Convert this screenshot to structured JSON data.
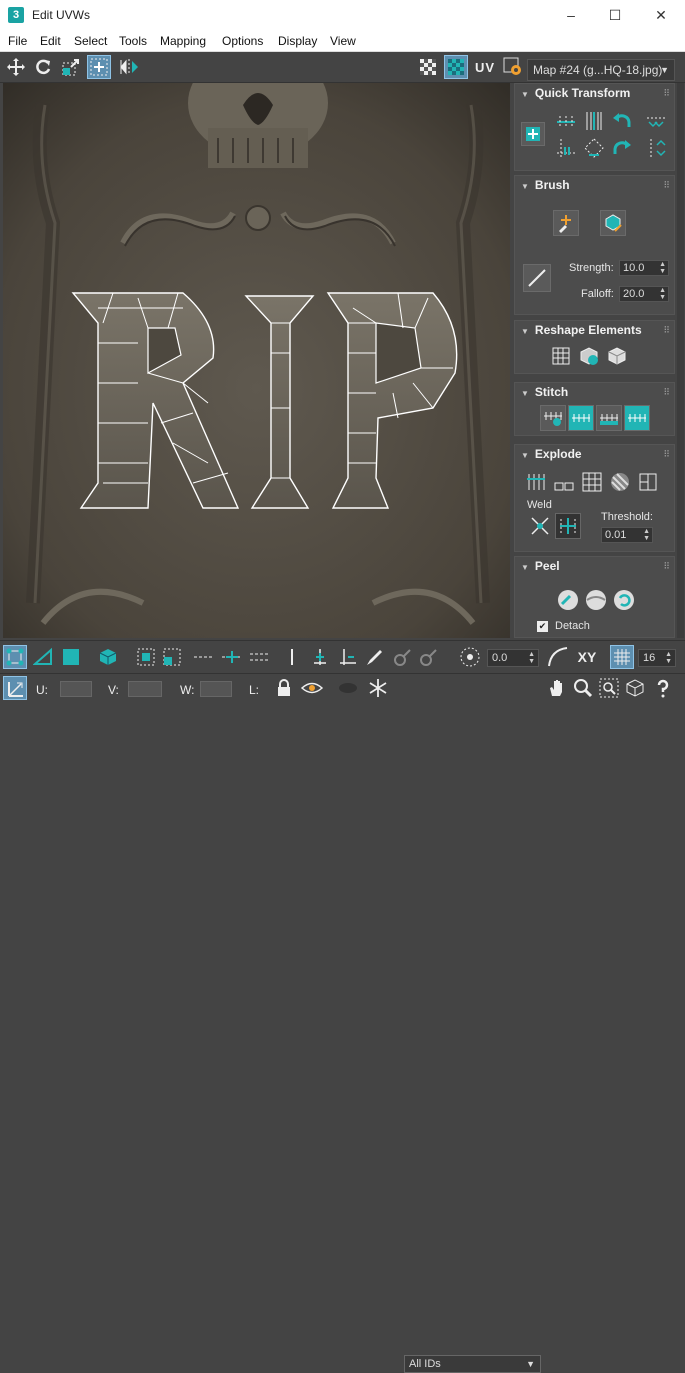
{
  "window": {
    "title": "Edit UVWs",
    "app_icon_label": "3"
  },
  "window_controls": {
    "minimize": "–",
    "maximize": "☐",
    "close": "✕"
  },
  "menu": [
    "File",
    "Edit",
    "Select",
    "Tools",
    "Mapping",
    "Options",
    "Display",
    "View"
  ],
  "toolbar": {
    "uv_label": "UV",
    "map_selector": "Map #24 (g...HQ-18.jpg)"
  },
  "viewport": {
    "texture_letters": "RIP"
  },
  "panels": {
    "quick_transform": {
      "title": "Quick Transform"
    },
    "brush": {
      "title": "Brush",
      "strength_label": "Strength:",
      "strength_value": "10.0",
      "falloff_label": "Falloff:",
      "falloff_value": "20.0"
    },
    "reshape_elements": {
      "title": "Reshape Elements"
    },
    "stitch": {
      "title": "Stitch"
    },
    "explode": {
      "title": "Explode",
      "weld_label": "Weld",
      "threshold_label": "Threshold:",
      "threshold_value": "0.01"
    },
    "peel": {
      "title": "Peel",
      "detach_label": "Detach",
      "detach_checked": true
    }
  },
  "bottom_toolbar": {
    "rotate_value": "0.0",
    "xy_label": "XY",
    "grid_value": "16",
    "u_label": "U:",
    "v_label": "V:",
    "w_label": "W:",
    "l_label": "L:",
    "id_filter": "All IDs"
  },
  "colors": {
    "accent": "#21b5b5",
    "active_button": "#5d8fb0",
    "panel_bg": "#444444"
  }
}
